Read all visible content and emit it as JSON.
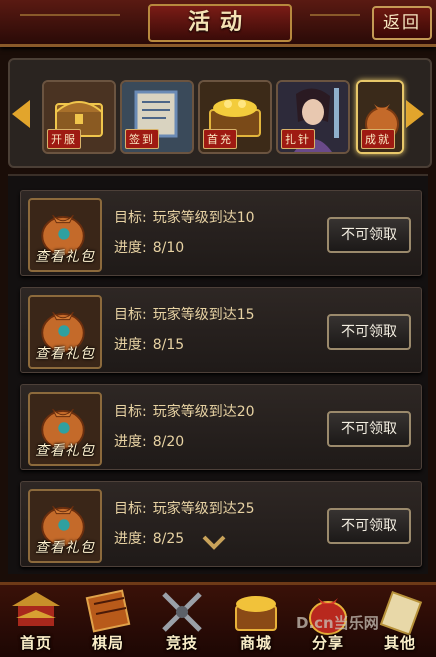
{
  "header": {
    "title": "活动",
    "back_label": "返回"
  },
  "tabs": [
    {
      "label": "开服",
      "icon": "treasure-chest-icon",
      "active": false
    },
    {
      "label": "签到",
      "icon": "scroll-icon",
      "active": false
    },
    {
      "label": "首充",
      "icon": "gold-chest-icon",
      "active": false
    },
    {
      "label": "扎针",
      "icon": "hero-portrait-icon",
      "active": false
    },
    {
      "label": "成就",
      "icon": "money-bag-icon",
      "active": true
    }
  ],
  "rewards": [
    {
      "gift_label": "查看礼包",
      "goal_key": "目标:",
      "goal_value": "玩家等级到达10",
      "progress_key": "进度:",
      "progress_value": "8/10",
      "button_label": "不可领取"
    },
    {
      "gift_label": "查看礼包",
      "goal_key": "目标:",
      "goal_value": "玩家等级到达15",
      "progress_key": "进度:",
      "progress_value": "8/15",
      "button_label": "不可领取"
    },
    {
      "gift_label": "查看礼包",
      "goal_key": "目标:",
      "goal_value": "玩家等级到达20",
      "progress_key": "进度:",
      "progress_value": "8/20",
      "button_label": "不可领取"
    },
    {
      "gift_label": "查看礼包",
      "goal_key": "目标:",
      "goal_value": "玩家等级到达25",
      "progress_key": "进度:",
      "progress_value": "8/25",
      "button_label": "不可领取"
    }
  ],
  "bottom_nav": [
    {
      "label": "首页",
      "icon": "palace-icon"
    },
    {
      "label": "棋局",
      "icon": "chessboard-icon"
    },
    {
      "label": "竞技",
      "icon": "crossed-swords-icon"
    },
    {
      "label": "商城",
      "icon": "shop-chest-icon"
    },
    {
      "label": "分享",
      "icon": "gift-sack-icon"
    },
    {
      "label": "其他",
      "icon": "scroll-icon"
    }
  ],
  "watermark": "D.cn当乐网",
  "colors": {
    "accent_gold": "#e2a52c",
    "tab_label_red": "#9e1a12",
    "header_red": "#5a1a12"
  }
}
